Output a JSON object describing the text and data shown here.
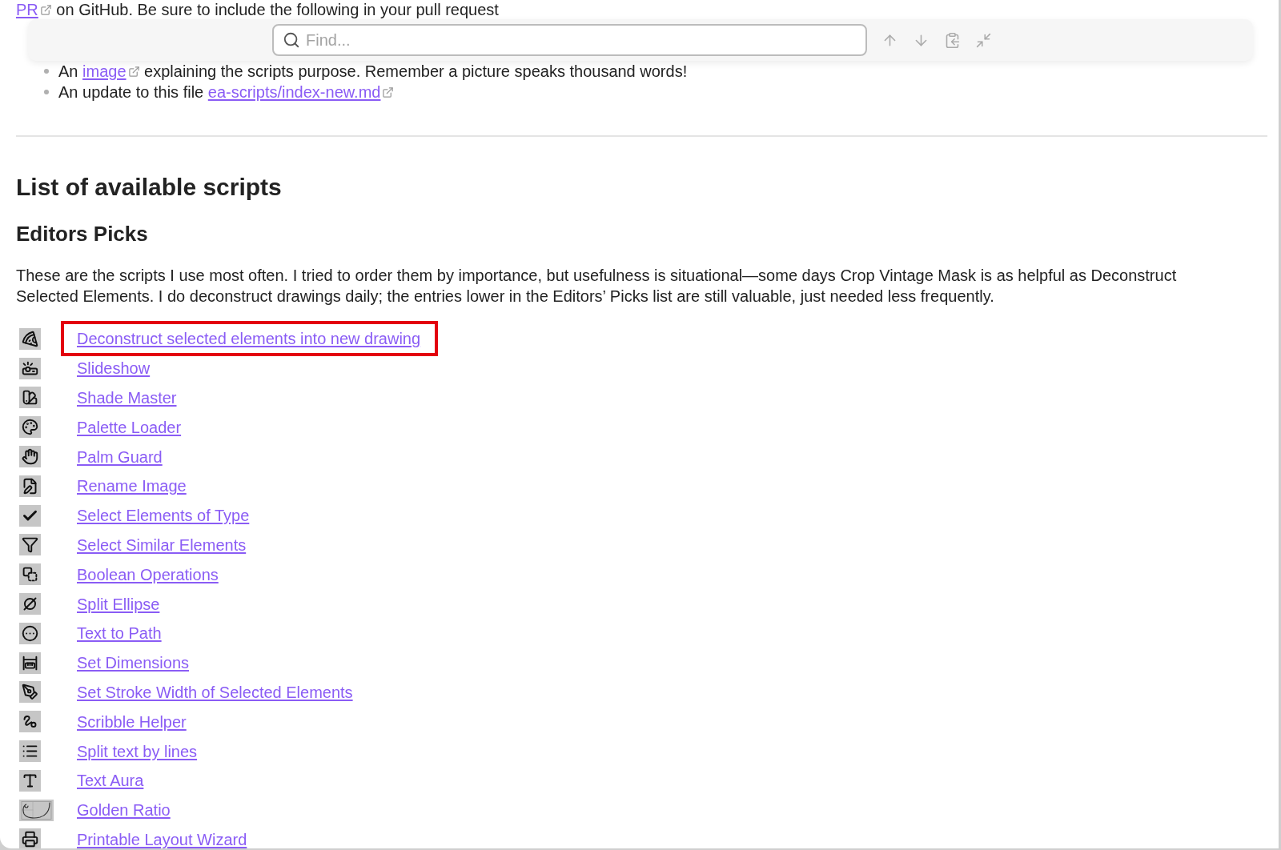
{
  "intro_line": {
    "link": "PR",
    "text": "on GitHub. Be sure to include the following in your pull request"
  },
  "find_bar": {
    "placeholder": "Find..."
  },
  "requirements": [
    {
      "before": "An",
      "link": "image",
      "after": "explaining the scripts purpose. Remember a picture speaks thousand words!"
    },
    {
      "before": "An update to this file",
      "link": "ea-scripts/index-new.md"
    }
  ],
  "heading": "List of available scripts",
  "section": {
    "title": "Editors Picks",
    "description": "These are the scripts I use most often. I tried to order them by importance, but usefulness is situational—some days Crop Vintage Mask is as helpful as Deconstruct Selected Elements. I do deconstruct drawings daily; the entries lower in the Editors’ Picks list are still valuable, just needed less frequently.",
    "scripts": [
      {
        "label": "Deconstruct selected elements into new drawing",
        "highlighted": true
      },
      {
        "label": "Slideshow",
        "highlighted": false
      },
      {
        "label": "Shade Master",
        "highlighted": false
      },
      {
        "label": "Palette Loader",
        "highlighted": false
      },
      {
        "label": "Palm Guard",
        "highlighted": false
      },
      {
        "label": "Rename Image",
        "highlighted": false
      },
      {
        "label": "Select Elements of Type",
        "highlighted": false
      },
      {
        "label": "Select Similar Elements",
        "highlighted": false
      },
      {
        "label": "Boolean Operations",
        "highlighted": false
      },
      {
        "label": "Split Ellipse",
        "highlighted": false
      },
      {
        "label": "Text to Path",
        "highlighted": false
      },
      {
        "label": "Set Dimensions",
        "highlighted": false
      },
      {
        "label": "Set Stroke Width of Selected Elements",
        "highlighted": false
      },
      {
        "label": "Scribble Helper",
        "highlighted": false
      },
      {
        "label": "Split text by lines",
        "highlighted": false
      },
      {
        "label": "Text Aura",
        "highlighted": false
      },
      {
        "label": "Golden Ratio",
        "highlighted": false
      },
      {
        "label": "Printable Layout Wizard",
        "highlighted": false
      }
    ]
  }
}
